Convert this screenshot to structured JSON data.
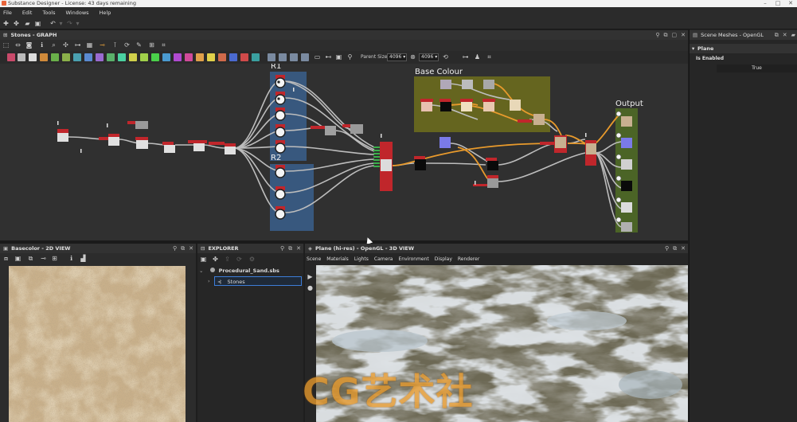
{
  "window": {
    "title": "Substance Designer - License: 43 days remaining"
  },
  "menu": [
    "File",
    "Edit",
    "Tools",
    "Windows",
    "Help"
  ],
  "graph": {
    "title": "Stones - GRAPH",
    "parent_size_label": "Parent Size:",
    "parent_size_value": "4096",
    "size_value": "4096",
    "frames": {
      "r1": "R1",
      "r2": "R2",
      "base_colour": "Base Colour",
      "output": "Output"
    }
  },
  "scene_panel": {
    "title": "Scene Meshes - OpenGL",
    "section": "Plane",
    "property_label": "Is Enabled",
    "property_value": "True"
  },
  "view2d": {
    "title": "Basecolor - 2D VIEW"
  },
  "explorer": {
    "title": "EXPLORER",
    "package": "Procedural_Sand.sbs",
    "graph_item": "Stones"
  },
  "view3d": {
    "title": "Plane (hi-res) - OpenGL - 3D VIEW",
    "menu": [
      "Scene",
      "Materials",
      "Lights",
      "Camera",
      "Environment",
      "Display",
      "Renderer"
    ]
  },
  "watermark": "CG艺术社",
  "colors": {
    "frame_blue": "#3a5f8c",
    "frame_olive": "#6b6b1e",
    "frame_green": "#4f6a26",
    "node_red": "#c0262b",
    "wire_orange": "#e89a2c",
    "selection_blue": "#3d7dd8"
  }
}
